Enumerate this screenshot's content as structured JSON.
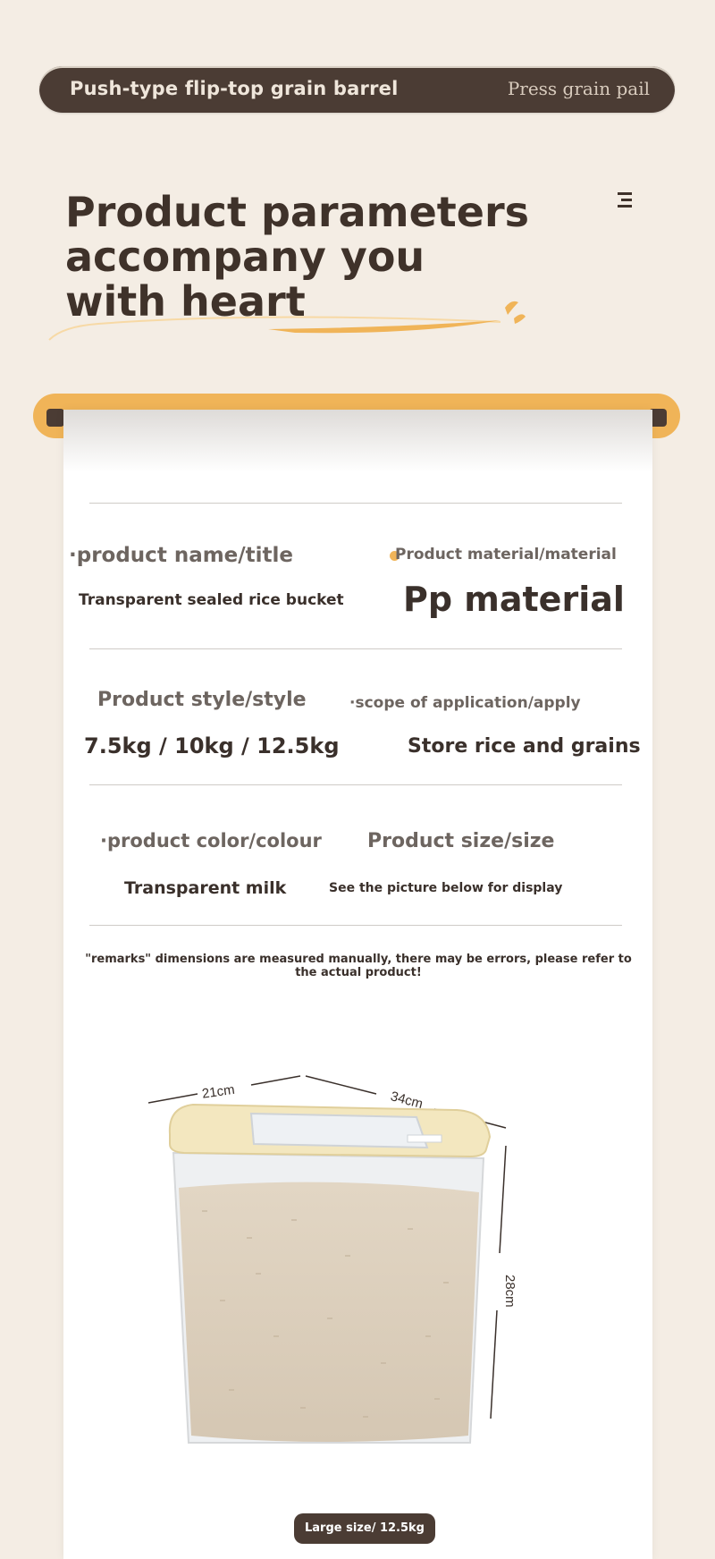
{
  "header": {
    "left_text": "Push-type flip-top grain barrel",
    "right_text": "Press grain pail"
  },
  "headline": {
    "line1": "Product parameters",
    "line2": "accompany you",
    "line3": "with heart"
  },
  "colors": {
    "brown": "#4b3c34",
    "accent": "#f0b458",
    "background": "#f4ede4"
  },
  "params": {
    "name_label": "·product name/title",
    "name_value": "Transparent sealed rice bucket",
    "material_label": "Product material/material",
    "material_value": "Pp material",
    "style_label": "Product style/style",
    "style_value": "7.5kg / 10kg / 12.5kg",
    "apply_label": "·scope of application/apply",
    "apply_value": "Store rice and grains",
    "color_label": "·product color/colour",
    "color_value": "Transparent milk",
    "size_label": "Product size/size",
    "size_value": "See the picture below for display"
  },
  "remark": "\"remarks\" dimensions are measured manually, there may be errors, please refer to the actual product!",
  "dimensions": {
    "width": "21cm",
    "length": "34cm",
    "height": "28cm"
  },
  "size_badge": "Large size/ 12.5kg"
}
